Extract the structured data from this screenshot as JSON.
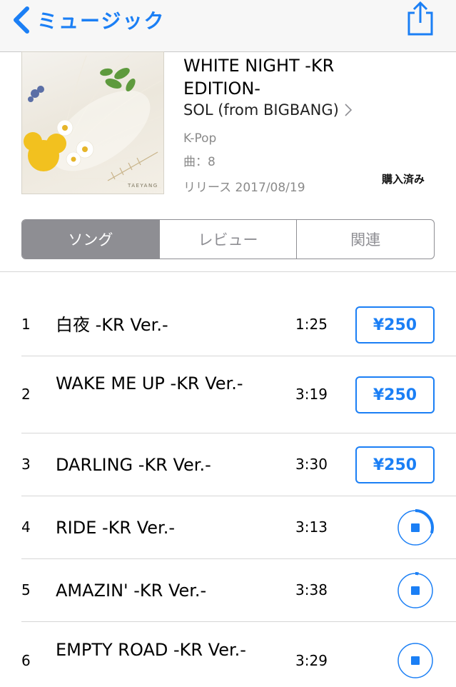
{
  "nav": {
    "back_label": "ミュージック",
    "colors": {
      "accent": "#1b7ff5",
      "bar_bg": "#f7f7f7"
    },
    "share_icon": "share-icon"
  },
  "album": {
    "artwork_text": "TAEYANG",
    "title": "WHITE NIGHT -KR EDITION-",
    "artist": "SOL (from BIGBANG)",
    "genre": "K-Pop",
    "track_count": "曲：8",
    "release": "リリース 2017/08/19",
    "purchased": "購入済み"
  },
  "tabs": [
    {
      "label": "ソング",
      "active": true
    },
    {
      "label": "レビュー",
      "active": false
    },
    {
      "label": "関連",
      "active": false
    }
  ],
  "tracks": [
    {
      "number": "1",
      "title": "白夜 -KR Ver.-",
      "duration": "1:25",
      "action": "price",
      "price": "¥250"
    },
    {
      "number": "2",
      "title": "WAKE ME UP -KR Ver.-",
      "duration": "3:19",
      "action": "price",
      "price": "¥250"
    },
    {
      "number": "3",
      "title": "DARLING -KR Ver.-",
      "duration": "3:30",
      "action": "price",
      "price": "¥250"
    },
    {
      "number": "4",
      "title": "RIDE -KR Ver.-",
      "duration": "3:13",
      "action": "downloading",
      "progress": 0.3
    },
    {
      "number": "5",
      "title": "AMAZIN' -KR Ver.-",
      "duration": "3:38",
      "action": "downloading",
      "progress": 0.03
    },
    {
      "number": "6",
      "title": "EMPTY ROAD -KR Ver.-",
      "duration": "3:29",
      "action": "downloading",
      "progress": 0.0
    }
  ]
}
